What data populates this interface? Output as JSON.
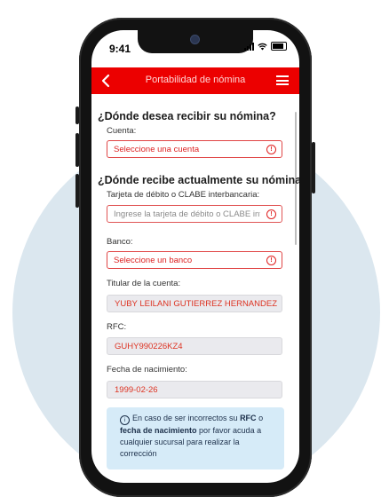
{
  "status_bar": {
    "time": "9:41"
  },
  "header": {
    "title": "Portabilidad de nómina"
  },
  "section1": {
    "heading": "¿Dónde desea recibir su nómina?",
    "account_label": "Cuenta:",
    "account_placeholder": "Seleccione una cuenta"
  },
  "section2": {
    "heading": "¿Dónde recibe actualmente su nómina?",
    "card_label": "Tarjeta de débito o CLABE interbancaria:",
    "card_placeholder": "Ingrese la tarjeta de débito o CLABE interbancaria",
    "bank_label": "Banco:",
    "bank_placeholder": "Seleccione un banco",
    "holder_label": "Titular de la cuenta:",
    "holder_value": "YUBY LEILANI GUTIERREZ HERNANDEZ",
    "rfc_label": "RFC:",
    "rfc_value": "GUHY990226KZ4",
    "dob_label": "Fecha de nacimiento:",
    "dob_value": "1999-02-26"
  },
  "info": {
    "part1": "En caso de ser incorrectos su ",
    "rfc": "RFC",
    "part2": " o ",
    "dob": "fecha de nacimiento",
    "part3": " por favor acuda a cualquier sucursal para realizar la corrección"
  },
  "colors": {
    "accent": "#ec0000",
    "info_bg": "#d6ebf8"
  }
}
